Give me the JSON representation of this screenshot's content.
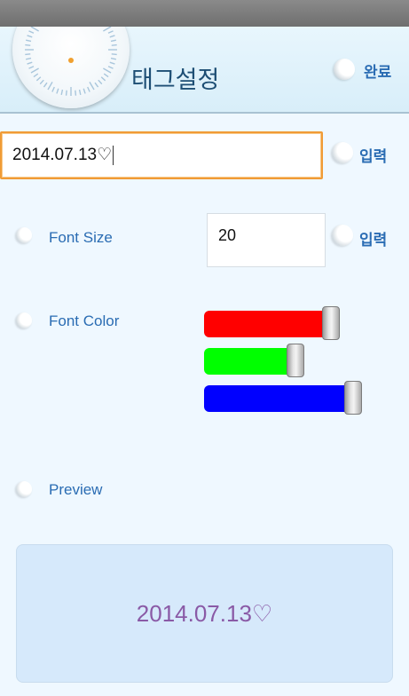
{
  "header": {
    "title": "태그설정",
    "done_label": "완료"
  },
  "tag_input": {
    "value": "2014.07.13♡",
    "submit_label": "입력"
  },
  "font_size": {
    "label": "Font Size",
    "value": "20",
    "submit_label": "입력"
  },
  "font_color": {
    "label": "Font Color",
    "sliders": [
      {
        "name": "red",
        "color": "#ff0000",
        "level": 0.83
      },
      {
        "name": "green",
        "color": "#00ff00",
        "level": 0.56
      },
      {
        "name": "blue",
        "color": "#0000ff",
        "level": 1.0
      }
    ]
  },
  "preview": {
    "label": "Preview",
    "text": "2014.07.13♡",
    "text_color": "#8a5aa6"
  },
  "icons": {
    "bullet": "bullet-icon",
    "dial": "clock-dial-icon"
  }
}
